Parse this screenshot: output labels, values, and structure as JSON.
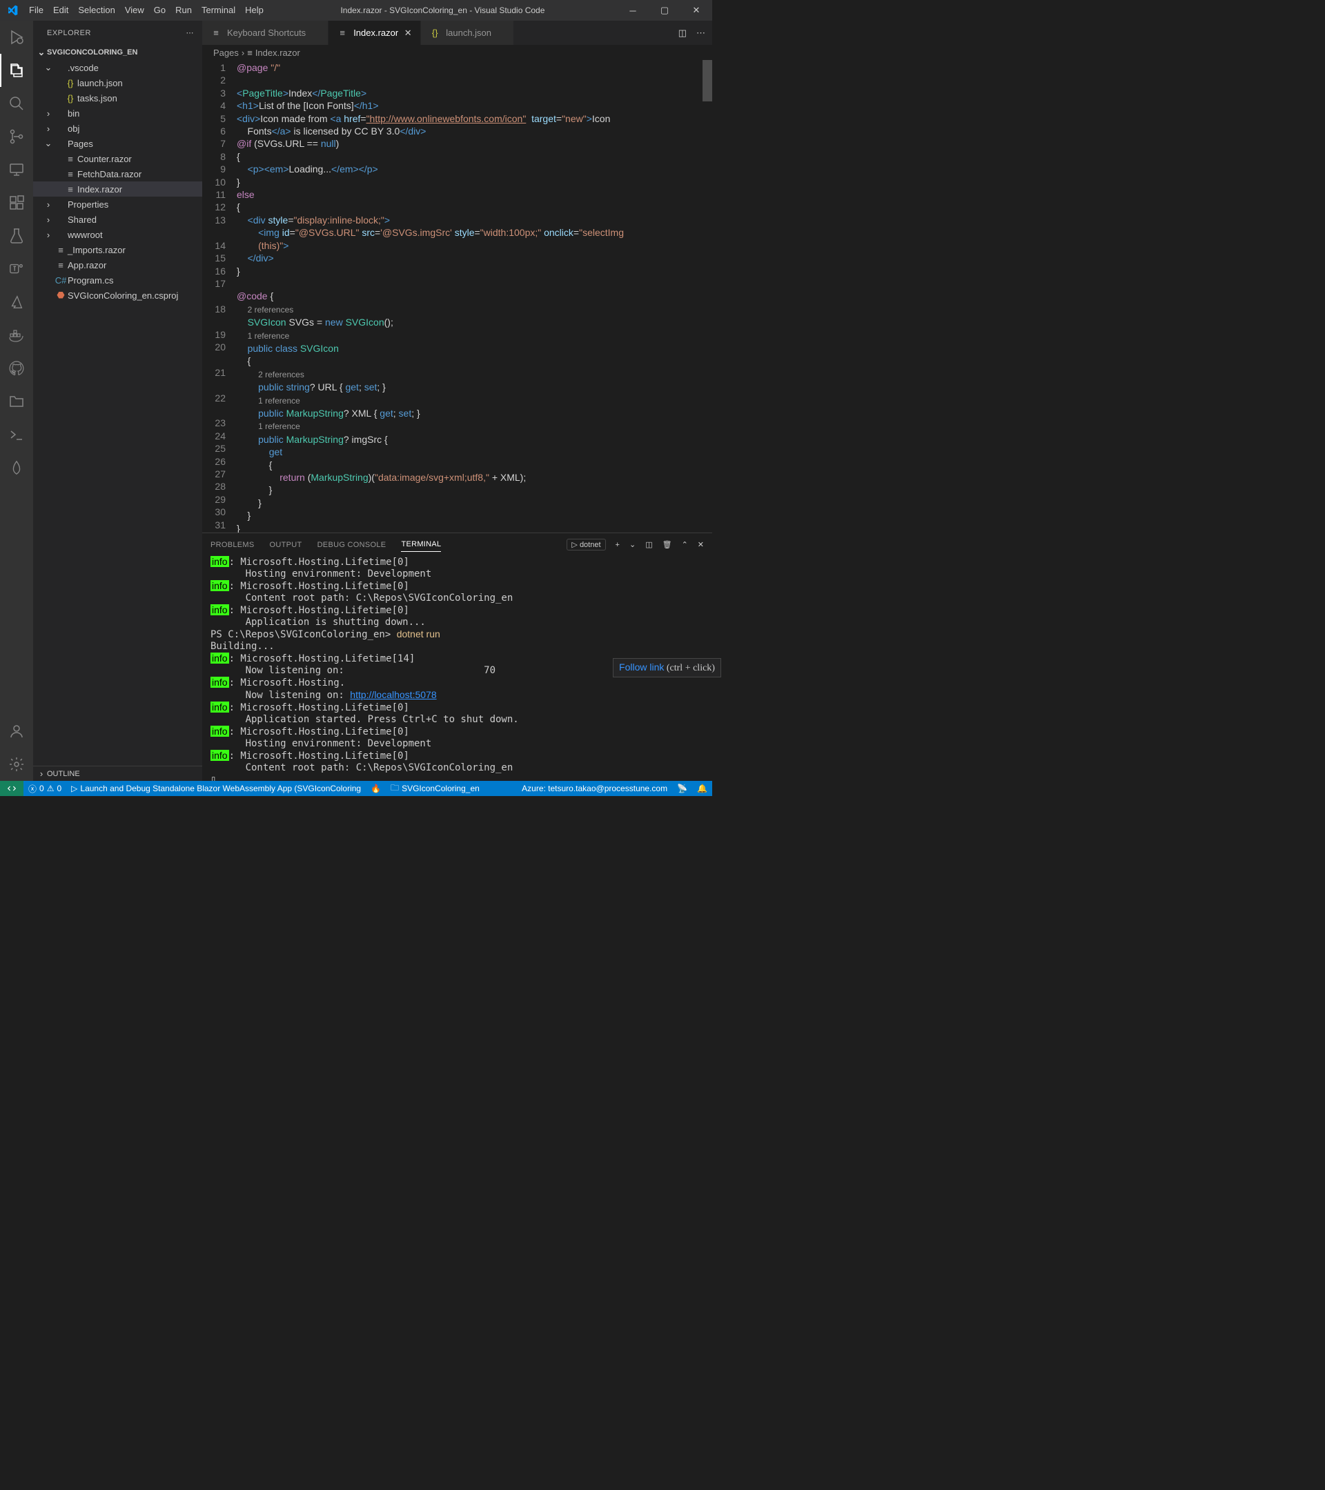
{
  "titlebar": {
    "menu": [
      "File",
      "Edit",
      "Selection",
      "View",
      "Go",
      "Run",
      "Terminal",
      "Help"
    ],
    "title": "Index.razor - SVGIconColoring_en - Visual Studio Code"
  },
  "sidebar": {
    "header": "EXPLORER",
    "project": "SVGICONCOLORING_EN",
    "tree": [
      {
        "indent": 1,
        "chev": "⌄",
        "icon": "",
        "label": ".vscode"
      },
      {
        "indent": 2,
        "chev": "",
        "icon": "{}",
        "cls": "json",
        "label": "launch.json"
      },
      {
        "indent": 2,
        "chev": "",
        "icon": "{}",
        "cls": "json",
        "label": "tasks.json"
      },
      {
        "indent": 1,
        "chev": "›",
        "icon": "",
        "label": "bin"
      },
      {
        "indent": 1,
        "chev": "›",
        "icon": "",
        "label": "obj"
      },
      {
        "indent": 1,
        "chev": "⌄",
        "icon": "",
        "label": "Pages"
      },
      {
        "indent": 2,
        "chev": "",
        "icon": "≡",
        "cls": "razor",
        "label": "Counter.razor"
      },
      {
        "indent": 2,
        "chev": "",
        "icon": "≡",
        "cls": "razor",
        "label": "FetchData.razor"
      },
      {
        "indent": 2,
        "chev": "",
        "icon": "≡",
        "cls": "razor",
        "label": "Index.razor",
        "sel": true
      },
      {
        "indent": 1,
        "chev": "›",
        "icon": "",
        "label": "Properties"
      },
      {
        "indent": 1,
        "chev": "›",
        "icon": "",
        "label": "Shared"
      },
      {
        "indent": 1,
        "chev": "›",
        "icon": "",
        "label": "wwwroot"
      },
      {
        "indent": 1,
        "chev": "",
        "icon": "≡",
        "cls": "razor",
        "label": "_Imports.razor"
      },
      {
        "indent": 1,
        "chev": "",
        "icon": "≡",
        "cls": "razor",
        "label": "App.razor"
      },
      {
        "indent": 1,
        "chev": "",
        "icon": "C#",
        "cls": "cs",
        "label": "Program.cs"
      },
      {
        "indent": 1,
        "chev": "",
        "icon": "⬣",
        "cls": "proj",
        "label": "SVGIconColoring_en.csproj"
      }
    ],
    "outline": "OUTLINE"
  },
  "tabs": [
    {
      "icon": "≡",
      "label": "Keyboard Shortcuts",
      "active": false,
      "close": false
    },
    {
      "icon": "≡",
      "label": "Index.razor",
      "active": true,
      "close": true
    },
    {
      "icon": "{}",
      "cls": "json",
      "label": "launch.json",
      "active": false,
      "close": false
    }
  ],
  "breadcrumb": [
    "Pages",
    "Index.razor"
  ],
  "gutterLines": [
    "1",
    "2",
    "3",
    "4",
    "5",
    "6",
    "7",
    "8",
    "9",
    "10",
    "11",
    "12",
    "13",
    "",
    "14",
    "15",
    "16",
    "17",
    "",
    "18",
    "",
    "19",
    "20",
    "",
    "21",
    "",
    "22",
    "",
    "23",
    "24",
    "25",
    "26",
    "27",
    "28",
    "29",
    "30",
    "31"
  ],
  "panel": {
    "tabs": [
      "PROBLEMS",
      "OUTPUT",
      "DEBUG CONSOLE",
      "TERMINAL"
    ],
    "active": 3,
    "select": "dotnet",
    "tooltip_link": "Follow link",
    "tooltip_hint": "(ctrl + click)",
    "lines": [
      {
        "pre": "info",
        "txt": ": Microsoft.Hosting.Lifetime[0]"
      },
      {
        "txt": "      Hosting environment: Development"
      },
      {
        "pre": "info",
        "txt": ": Microsoft.Hosting.Lifetime[0]"
      },
      {
        "txt": "      Content root path: C:\\Repos\\SVGIconColoring_en"
      },
      {
        "pre": "info",
        "txt": ": Microsoft.Hosting.Lifetime[0]"
      },
      {
        "txt": "      Application is shutting down..."
      },
      {
        "txt": "PS C:\\Repos\\SVGIconColoring_en> ",
        "cmd": "dotnet run"
      },
      {
        "txt": "Building..."
      },
      {
        "pre": "info",
        "txt": ": Microsoft.Hosting.Lifetime[14]"
      },
      {
        "txt": "      Now listening on:                        70",
        "tooltip": true
      },
      {
        "pre": "info",
        "txt": ": Microsoft.Hosting."
      },
      {
        "txt": "      Now listening on: ",
        "link": "http://localhost:5078"
      },
      {
        "pre": "info",
        "txt": ": Microsoft.Hosting.Lifetime[0]"
      },
      {
        "txt": "      Application started. Press Ctrl+C to shut down."
      },
      {
        "pre": "info",
        "txt": ": Microsoft.Hosting.Lifetime[0]"
      },
      {
        "txt": "      Hosting environment: Development"
      },
      {
        "pre": "info",
        "txt": ": Microsoft.Hosting.Lifetime[0]"
      },
      {
        "txt": "      Content root path: C:\\Repos\\SVGIconColoring_en"
      },
      {
        "txt": "▯"
      }
    ]
  },
  "status": {
    "errors": "0",
    "warnings": "0",
    "launch": "Launch and Debug Standalone Blazor WebAssembly App (SVGIconColoring",
    "folder": "SVGIconColoring_en",
    "azure": "Azure: tetsuro.takao@processtune.com"
  }
}
